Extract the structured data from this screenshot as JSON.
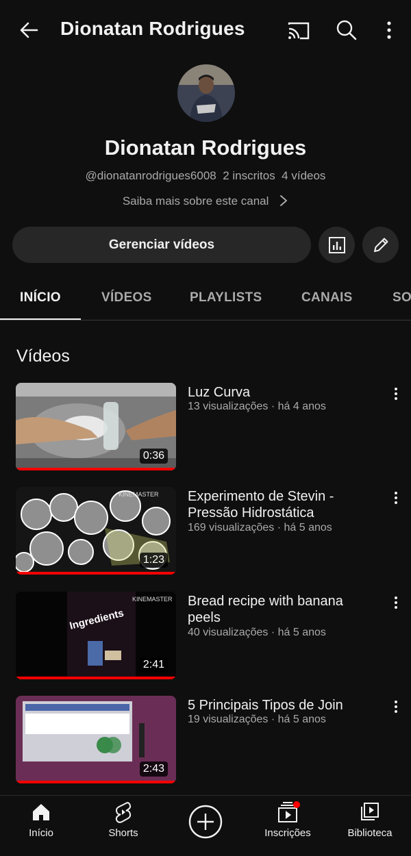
{
  "header": {
    "title": "Dionatan Rodrigues",
    "icons": [
      "back-arrow-icon",
      "cast-icon",
      "search-icon",
      "more-vert-icon"
    ]
  },
  "channel": {
    "name": "Dionatan Rodrigues",
    "handle": "@dionatanrodrigues6008",
    "subscribers": "2 inscritos",
    "videos_count": "4 vídeos",
    "about_link": "Saiba mais sobre este canal",
    "manage_button": "Gerenciar vídeos"
  },
  "tabs": [
    {
      "label": "INÍCIO",
      "active": true
    },
    {
      "label": "VÍDEOS"
    },
    {
      "label": "PLAYLISTS"
    },
    {
      "label": "CANAIS"
    },
    {
      "label": "SO"
    }
  ],
  "section": {
    "title": "Vídeos"
  },
  "videos": [
    {
      "title": "Luz Curva",
      "meta": "13 visualizações · há 4 anos",
      "duration": "0:36"
    },
    {
      "title": "Experimento de Stevin - Pressão Hidrostática",
      "meta": "169 visualizações · há 5 anos",
      "duration": "1:23"
    },
    {
      "title": "Bread recipe with banana peels",
      "meta": "40 visualizações · há 5 anos",
      "duration": "2:41"
    },
    {
      "title": "5 Principais Tipos de Join",
      "meta": "19 visualizações · há 5 anos",
      "duration": "2:43"
    }
  ],
  "thumb_text": {
    "watermark": "KINEMASTER",
    "ingredients": "Ingredients"
  },
  "bottom_nav": [
    {
      "label": "Início",
      "active": true
    },
    {
      "label": "Shorts"
    },
    {
      "label": ""
    },
    {
      "label": "Inscrições",
      "badge": true
    },
    {
      "label": "Biblioteca"
    }
  ],
  "colors": {
    "background": "#0f0f0f",
    "surface": "#272727",
    "text": "#f1f1f1",
    "secondary": "#aaaaaa",
    "accent_red": "#ff0000"
  }
}
